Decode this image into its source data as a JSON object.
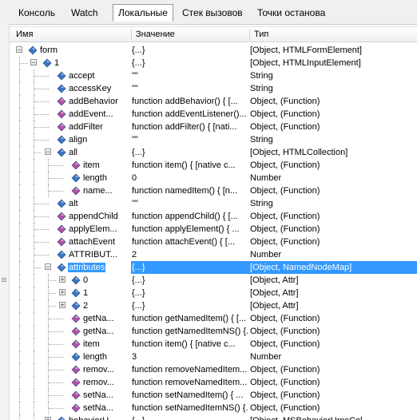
{
  "tabs": [
    {
      "label": "Консоль",
      "active": false
    },
    {
      "label": "Watch",
      "active": false
    },
    {
      "label": "Локальные",
      "active": true
    },
    {
      "label": "Стек вызовов",
      "active": false
    },
    {
      "label": "Точки останова",
      "active": false
    }
  ],
  "columns": {
    "name": "Имя",
    "value": "Значение",
    "type": "Тип"
  },
  "colors": {
    "selection": "#3399ff",
    "object_icon": "#3a78c8",
    "method_icon": "#b84fa8"
  },
  "rows": [
    {
      "depth": 0,
      "expander": "-",
      "icon": "object",
      "name": "form",
      "value": "{...}",
      "type": "[Object, HTMLFormElement]"
    },
    {
      "depth": 1,
      "expander": "-",
      "icon": "object",
      "name": "1",
      "value": "{...}",
      "type": "[Object, HTMLInputElement]"
    },
    {
      "depth": 2,
      "expander": "",
      "icon": "object",
      "name": "accept",
      "value": "\"\"",
      "type": "String"
    },
    {
      "depth": 2,
      "expander": "",
      "icon": "object",
      "name": "accessKey",
      "value": "\"\"",
      "type": "String"
    },
    {
      "depth": 2,
      "expander": "",
      "icon": "method",
      "name": "addBehavior",
      "value": "function addBehavior() {    [...",
      "type": "Object, (Function)"
    },
    {
      "depth": 2,
      "expander": "",
      "icon": "method",
      "name": "addEvent...",
      "value": "function addEventListener()...",
      "type": "Object, (Function)"
    },
    {
      "depth": 2,
      "expander": "",
      "icon": "method",
      "name": "addFilter",
      "value": "function addFilter() {    [nati...",
      "type": "Object, (Function)"
    },
    {
      "depth": 2,
      "expander": "",
      "icon": "object",
      "name": "align",
      "value": "\"\"",
      "type": "String"
    },
    {
      "depth": 2,
      "expander": "-",
      "icon": "object",
      "name": "all",
      "value": "{...}",
      "type": "[Object, HTMLCollection]"
    },
    {
      "depth": 3,
      "expander": "",
      "icon": "method",
      "name": "item",
      "value": "function item() {    [native c...",
      "type": "Object, (Function)"
    },
    {
      "depth": 3,
      "expander": "",
      "icon": "object",
      "name": "length",
      "value": "0",
      "type": "Number"
    },
    {
      "depth": 3,
      "expander": "",
      "icon": "method",
      "name": "name...",
      "value": "function namedItem() {    [n...",
      "type": "Object, (Function)"
    },
    {
      "depth": 2,
      "expander": "",
      "icon": "object",
      "name": "alt",
      "value": "\"\"",
      "type": "String"
    },
    {
      "depth": 2,
      "expander": "",
      "icon": "method",
      "name": "appendChild",
      "value": "function appendChild() {    [...",
      "type": "Object, (Function)"
    },
    {
      "depth": 2,
      "expander": "",
      "icon": "method",
      "name": "applyElem...",
      "value": "function applyElement() {    ...",
      "type": "Object, (Function)"
    },
    {
      "depth": 2,
      "expander": "",
      "icon": "method",
      "name": "attachEvent",
      "value": "function attachEvent() {    [...",
      "type": "Object, (Function)"
    },
    {
      "depth": 2,
      "expander": "",
      "icon": "object",
      "name": "ATTRIBUT...",
      "value": "2",
      "type": "Number"
    },
    {
      "depth": 2,
      "expander": "-",
      "icon": "object",
      "name": "attributes",
      "value": "{...}",
      "type": "[Object, NamedNodeMap]",
      "selected": true
    },
    {
      "depth": 3,
      "expander": "+",
      "icon": "object",
      "name": "0",
      "value": "{...}",
      "type": "[Object, Attr]"
    },
    {
      "depth": 3,
      "expander": "+",
      "icon": "object",
      "name": "1",
      "value": "{...}",
      "type": "[Object, Attr]"
    },
    {
      "depth": 3,
      "expander": "+",
      "icon": "object",
      "name": "2",
      "value": "{...}",
      "type": "[Object, Attr]"
    },
    {
      "depth": 3,
      "expander": "",
      "icon": "method",
      "name": "getNa...",
      "value": "function getNamedItem() {    [...",
      "type": "Object, (Function)"
    },
    {
      "depth": 3,
      "expander": "",
      "icon": "method",
      "name": "getNa...",
      "value": "function getNamedItemNS() {...",
      "type": "Object, (Function)"
    },
    {
      "depth": 3,
      "expander": "",
      "icon": "method",
      "name": "item",
      "value": "function item() {    [native c...",
      "type": "Object, (Function)"
    },
    {
      "depth": 3,
      "expander": "",
      "icon": "object",
      "name": "length",
      "value": "3",
      "type": "Number"
    },
    {
      "depth": 3,
      "expander": "",
      "icon": "method",
      "name": "remov...",
      "value": "function removeNamedItem...",
      "type": "Object, (Function)"
    },
    {
      "depth": 3,
      "expander": "",
      "icon": "method",
      "name": "remov...",
      "value": "function removeNamedItem...",
      "type": "Object, (Function)"
    },
    {
      "depth": 3,
      "expander": "",
      "icon": "method",
      "name": "setNa...",
      "value": "function setNamedItem() {    ...",
      "type": "Object, (Function)"
    },
    {
      "depth": 3,
      "expander": "",
      "icon": "method",
      "name": "setNa...",
      "value": "function setNamedItemNS() {...",
      "type": "Object, (Function)"
    },
    {
      "depth": 2,
      "expander": "+",
      "icon": "object",
      "name": "behaviorU...",
      "value": "{...}",
      "type": "[Object, MSBehaviorUrnsCol..."
    }
  ]
}
